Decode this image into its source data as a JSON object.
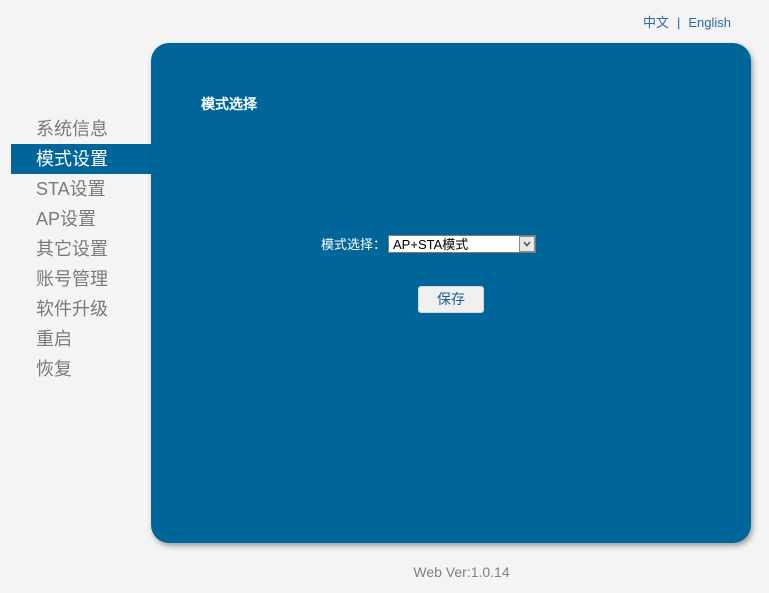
{
  "language_bar": {
    "chinese_label": "中文",
    "separator": "|",
    "english_label": "English"
  },
  "sidebar": {
    "items": [
      {
        "label": "系统信息",
        "active": false
      },
      {
        "label": "模式设置",
        "active": true
      },
      {
        "label": "STA设置",
        "active": false
      },
      {
        "label": "AP设置",
        "active": false
      },
      {
        "label": "其它设置",
        "active": false
      },
      {
        "label": "账号管理",
        "active": false
      },
      {
        "label": "软件升级",
        "active": false
      },
      {
        "label": "重启",
        "active": false
      },
      {
        "label": "恢复",
        "active": false
      }
    ]
  },
  "panel": {
    "title": "模式选择",
    "mode_field": {
      "label": "模式选择：",
      "selected_value": "AP+STA模式",
      "arrow_icon": "chevron-down-icon"
    },
    "save_label": "保存"
  },
  "footer": {
    "version_text": "Web Ver:1.0.14"
  },
  "colors": {
    "accent": "#006699",
    "background": "#f4f4f4",
    "nav_text": "#7a7a7a",
    "link": "#2a6aa8"
  }
}
